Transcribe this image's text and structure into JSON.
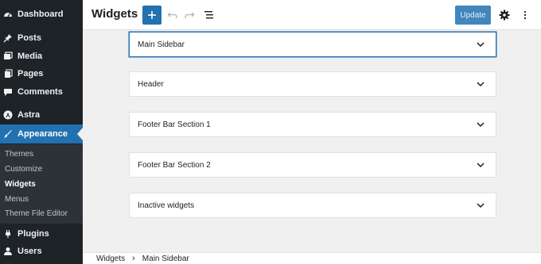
{
  "header": {
    "title": "Widgets",
    "update_label": "Update"
  },
  "sidebar": {
    "items": [
      {
        "label": "Dashboard",
        "icon": "dashboard-icon"
      },
      {
        "label": "Posts",
        "icon": "pin-icon"
      },
      {
        "label": "Media",
        "icon": "media-icon"
      },
      {
        "label": "Pages",
        "icon": "pages-icon"
      },
      {
        "label": "Comments",
        "icon": "comments-icon"
      },
      {
        "label": "Astra",
        "icon": "astra-icon"
      },
      {
        "label": "Appearance",
        "icon": "brush-icon"
      },
      {
        "label": "Plugins",
        "icon": "plugin-icon"
      },
      {
        "label": "Users",
        "icon": "users-icon"
      }
    ],
    "submenu": [
      "Themes",
      "Customize",
      "Widgets",
      "Menus",
      "Theme File Editor"
    ]
  },
  "areas": [
    {
      "label": "Main Sidebar"
    },
    {
      "label": "Header"
    },
    {
      "label": "Footer Bar Section 1"
    },
    {
      "label": "Footer Bar Section 2"
    },
    {
      "label": "Inactive widgets"
    }
  ],
  "breadcrumb": {
    "items": [
      "Widgets",
      "Main Sidebar"
    ],
    "separator": "›"
  },
  "colors": {
    "accent": "#2271b1",
    "sidebar_bg": "#1d2327"
  }
}
